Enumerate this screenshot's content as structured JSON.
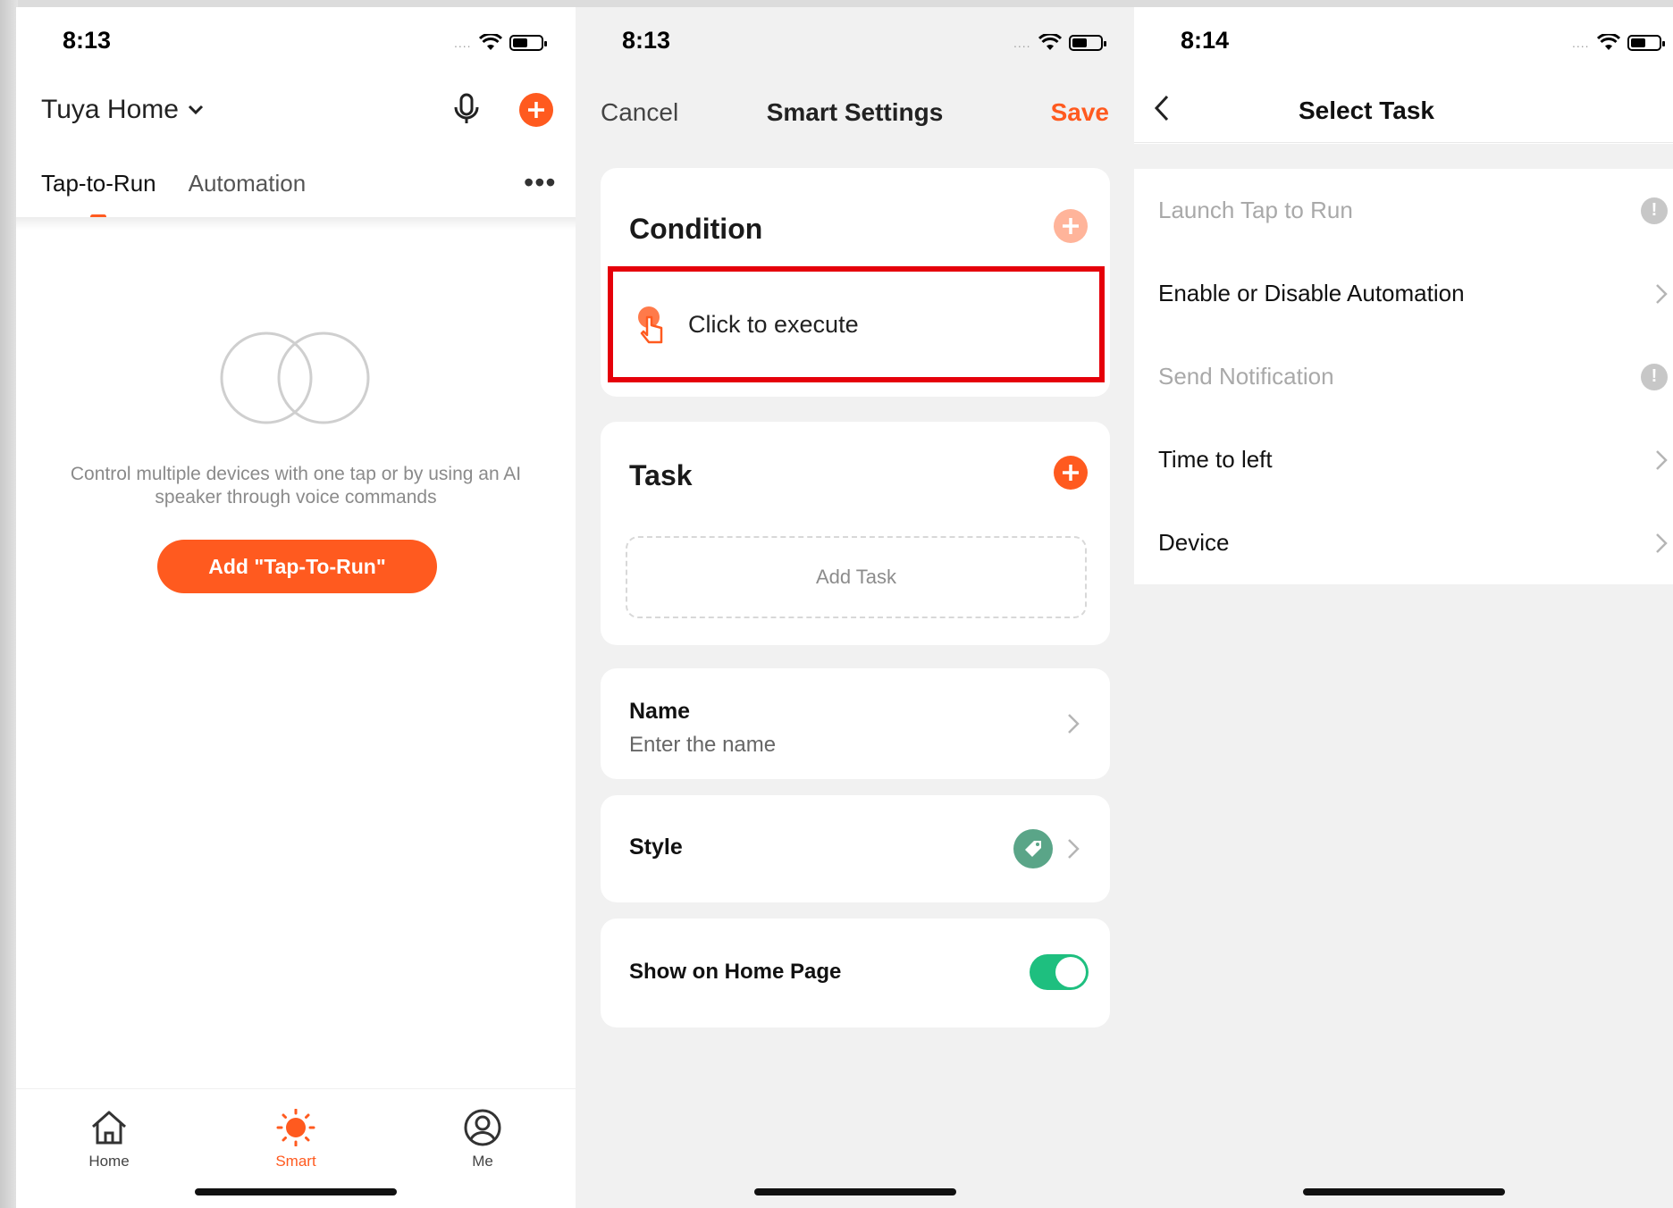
{
  "status": {
    "screen1_time": "8:13",
    "screen2_time": "8:13",
    "screen3_time": "8:14"
  },
  "screen1": {
    "home_title": "Tuya Home",
    "tabs": [
      "Tap-to-Run",
      "Automation"
    ],
    "more": "•••",
    "description": "Control multiple devices with one tap or by using an AI speaker through voice commands",
    "add_button": "Add \"Tap-To-Run\"",
    "tabbar": [
      {
        "label": "Home",
        "icon": "house-icon"
      },
      {
        "label": "Smart",
        "icon": "sun-icon"
      },
      {
        "label": "Me",
        "icon": "person-icon"
      }
    ],
    "accent_color": "#ff5a1f"
  },
  "screen2": {
    "cancel": "Cancel",
    "title": "Smart Settings",
    "save": "Save",
    "condition_title": "Condition",
    "condition_item": "Click to execute",
    "task_title": "Task",
    "add_task": "Add Task",
    "name_label": "Name",
    "name_placeholder": "Enter the name",
    "style_label": "Style",
    "show_home_label": "Show on Home Page",
    "show_home_enabled": true,
    "highlight_color": "#e5000a",
    "toggle_color": "#1ebf7f"
  },
  "screen3": {
    "title": "Select Task",
    "items": [
      {
        "label": "Launch Tap to Run",
        "disabled": true,
        "right": "info-icon"
      },
      {
        "label": "Enable or Disable Automation",
        "disabled": false,
        "right": "chevron-right-icon"
      },
      {
        "label": "Send Notification",
        "disabled": true,
        "right": "info-icon"
      },
      {
        "label": "Time to left",
        "disabled": false,
        "right": "chevron-right-icon"
      },
      {
        "label": "Device",
        "disabled": false,
        "right": "chevron-right-icon"
      }
    ]
  }
}
